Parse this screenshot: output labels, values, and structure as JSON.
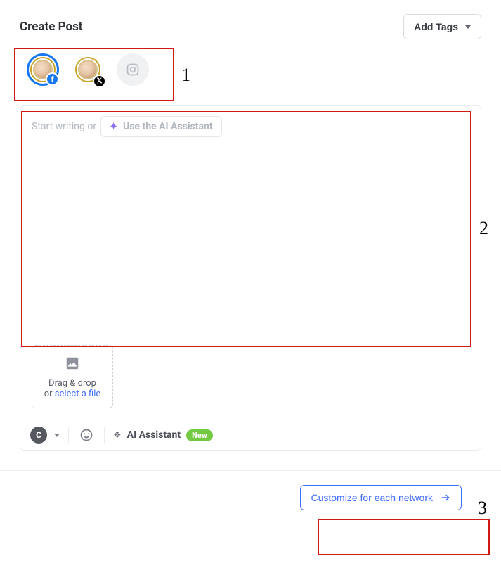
{
  "header": {
    "title": "Create Post",
    "add_tags_label": "Add Tags"
  },
  "annotations": {
    "n1": "1",
    "n2": "2",
    "n3": "3"
  },
  "accounts": [
    {
      "network": "facebook",
      "selected": true
    },
    {
      "network": "x",
      "selected": false
    },
    {
      "network": "instagram",
      "selected": false,
      "disabled": true
    }
  ],
  "composer": {
    "placeholder_prefix": "Start writing or",
    "ai_inline_label": "Use the AI Assistant"
  },
  "media": {
    "line1": "Drag & drop",
    "line2_prefix": "or ",
    "link_text": "select a file"
  },
  "toolbar": {
    "chip_letter": "C",
    "ai_label": "AI Assistant",
    "new_label": "New"
  },
  "footer": {
    "customize_label": "Customize for each network"
  }
}
